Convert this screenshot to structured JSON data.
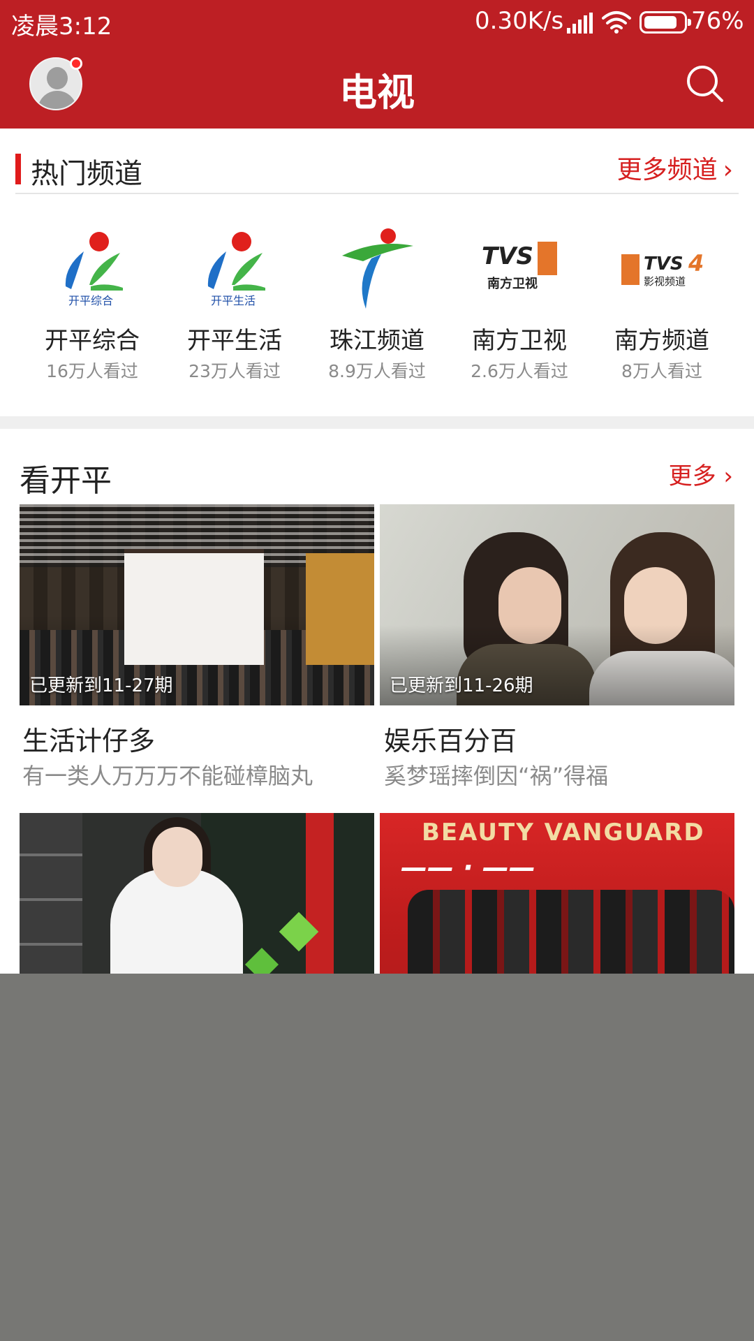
{
  "status_bar": {
    "time": "凌晨3:12",
    "network_speed": "0.30K/s",
    "battery": "76%",
    "icons": [
      "signal-icon",
      "wifi-icon",
      "battery-icon"
    ]
  },
  "app_bar": {
    "title": "电视",
    "avatar_icon": "user-avatar-icon",
    "search_icon": "search-icon",
    "accent_color": "#bd1f24"
  },
  "hot_channels": {
    "title": "热门频道",
    "more_label": "更多频道",
    "channels": [
      {
        "name": "开平综合",
        "views": "16万人看过",
        "logo_text": "开平综合"
      },
      {
        "name": "开平生活",
        "views": "23万人看过",
        "logo_text": "开平生活"
      },
      {
        "name": "珠江频道",
        "views": "8.9万人看过",
        "logo_text": ""
      },
      {
        "name": "南方卫视",
        "views": "2.6万人看过",
        "logo_text": "南方卫视"
      },
      {
        "name": "南方频道",
        "views": "8万人看过",
        "logo_text": "影视频道"
      }
    ]
  },
  "kaiping": {
    "title": "看开平",
    "more_label": "更多",
    "cards": [
      {
        "caption": "已更新到11-27期",
        "title": "生活计仔多",
        "subtitle": "有一类人万万万不能碰樟脑丸"
      },
      {
        "caption": "已更新到11-26期",
        "title": "娱乐百分百",
        "subtitle": "奚梦瑶摔倒因“祸”得福"
      },
      {
        "caption": "",
        "title": "",
        "subtitle": ""
      },
      {
        "caption": "",
        "title": "",
        "subtitle": ""
      }
    ]
  },
  "colors": {
    "brand_red": "#bd1f24",
    "link_red": "#d61f1f",
    "overlay_gray": "#777774"
  }
}
